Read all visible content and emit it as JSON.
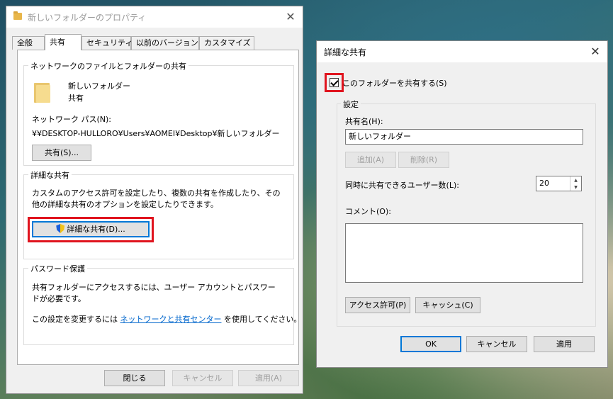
{
  "properties_window": {
    "title": "新しいフォルダーのプロパティ",
    "close_glyph": "✕",
    "tabs": [
      {
        "label": "全般"
      },
      {
        "label": "共有"
      },
      {
        "label": "セキュリティ"
      },
      {
        "label": "以前のバージョン"
      },
      {
        "label": "カスタマイズ"
      }
    ],
    "active_tab": "共有",
    "network_group": {
      "legend": "ネットワークのファイルとフォルダーの共有",
      "folder_name": "新しいフォルダー",
      "folder_status": "共有",
      "path_label": "ネットワーク パス(N):",
      "path_value": "¥¥DESKTOP-HULLORO¥Users¥AOMEI¥Desktop¥新しいフォルダー",
      "share_button": "共有(S)..."
    },
    "advanced_group": {
      "legend": "詳細な共有",
      "description": "カスタムのアクセス許可を設定したり、複数の共有を作成したり、その他の詳細な共有のオプションを設定したりできます。",
      "button": "詳細な共有(D)..."
    },
    "password_group": {
      "legend": "パスワード保護",
      "description": "共有フォルダーにアクセスするには、ユーザー アカウントとパスワードが必要です。",
      "change_prefix": "この設定を変更するには ",
      "change_link": "ネットワークと共有センター",
      "change_suffix": " を使用してください。"
    },
    "footer": {
      "close": "閉じる",
      "cancel": "キャンセル",
      "apply": "適用(A)"
    }
  },
  "advanced_window": {
    "title": "詳細な共有",
    "close_glyph": "✕",
    "share_checkbox_label": "このフォルダーを共有する(S)",
    "share_checked": true,
    "settings_legend": "設定",
    "share_name_label": "共有名(H):",
    "share_name_value": "新しいフォルダー",
    "add_button": "追加(A)",
    "remove_button": "削除(R)",
    "user_limit_label": "同時に共有できるユーザー数(L):",
    "user_limit_value": "20",
    "comment_label": "コメント(O):",
    "comment_value": "",
    "permissions_button": "アクセス許可(P)",
    "cache_button": "キャッシュ(C)",
    "ok": "OK",
    "cancel": "キャンセル",
    "apply": "適用"
  },
  "colors": {
    "highlight": "#e0141e",
    "link": "#0066cc",
    "focus": "#0078d7"
  }
}
